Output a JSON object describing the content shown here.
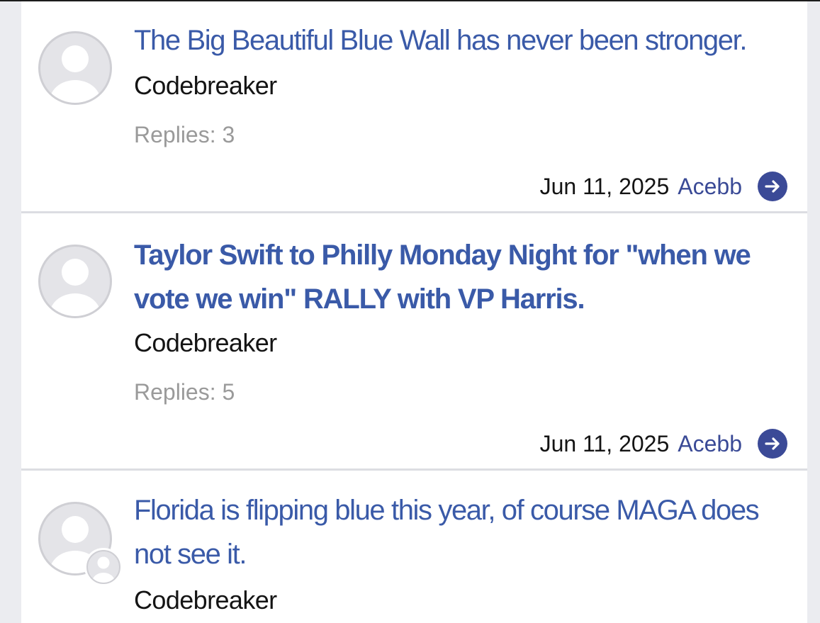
{
  "threads": [
    {
      "title": "The Big Beautiful Blue Wall has never been stronger.",
      "author": "Codebreaker",
      "replies": "Replies: 3",
      "date": "Jun 11, 2025",
      "last_poster": "Acebb",
      "unread": false
    },
    {
      "title": "Taylor Swift to Philly Monday Night for \"when we vote we win\" RALLY with VP Harris.",
      "author": "Codebreaker",
      "replies": "Replies: 5",
      "date": "Jun 11, 2025",
      "last_poster": "Acebb",
      "unread": true
    },
    {
      "title": "Florida is flipping blue this year, of course MAGA does not see it.",
      "author": "Codebreaker",
      "unread": false
    }
  ],
  "colors": {
    "title_link": "#3a5aa8",
    "last_poster": "#3a4a96",
    "goto_button": "#3b4a97",
    "replies_text": "#9a9a9a",
    "page_bg": "#ebecf0"
  },
  "icons": {
    "avatar": "default-user-icon",
    "goto": "arrow-right-circle-icon"
  }
}
